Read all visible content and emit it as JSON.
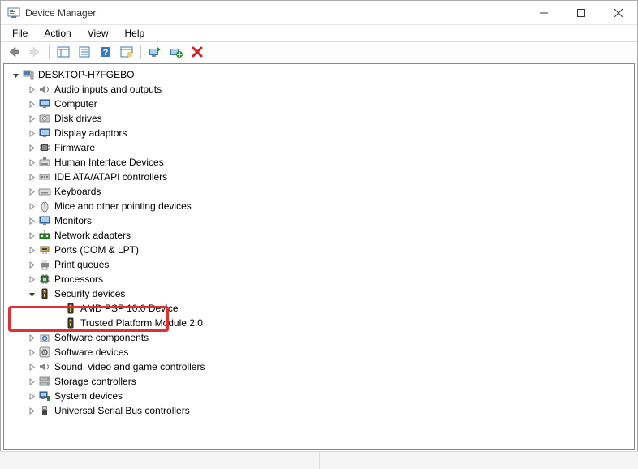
{
  "window": {
    "title": "Device Manager"
  },
  "menu": {
    "file": "File",
    "action": "Action",
    "view": "View",
    "help": "Help"
  },
  "tree": {
    "root": "DESKTOP-H7FGEBO",
    "items": [
      {
        "label": "Audio inputs and outputs",
        "icon": "speaker"
      },
      {
        "label": "Computer",
        "icon": "monitor"
      },
      {
        "label": "Disk drives",
        "icon": "disk"
      },
      {
        "label": "Display adaptors",
        "icon": "monitor"
      },
      {
        "label": "Firmware",
        "icon": "chip"
      },
      {
        "label": "Human Interface Devices",
        "icon": "hid"
      },
      {
        "label": "IDE ATA/ATAPI controllers",
        "icon": "ide"
      },
      {
        "label": "Keyboards",
        "icon": "keyboard"
      },
      {
        "label": "Mice and other pointing devices",
        "icon": "mouse"
      },
      {
        "label": "Monitors",
        "icon": "monitor"
      },
      {
        "label": "Network adapters",
        "icon": "net"
      },
      {
        "label": "Ports (COM & LPT)",
        "icon": "port"
      },
      {
        "label": "Print queues",
        "icon": "printer"
      },
      {
        "label": "Processors",
        "icon": "cpu"
      },
      {
        "label": "Security devices",
        "icon": "security",
        "expanded": true,
        "children": [
          {
            "label": "AMD PSP 10.0 Device",
            "icon": "security"
          },
          {
            "label": "Trusted Platform Module 2.0",
            "icon": "security",
            "highlighted": true
          }
        ]
      },
      {
        "label": "Software components",
        "icon": "swcomp"
      },
      {
        "label": "Software devices",
        "icon": "swdev"
      },
      {
        "label": "Sound, video and game controllers",
        "icon": "speaker"
      },
      {
        "label": "Storage controllers",
        "icon": "storage"
      },
      {
        "label": "System devices",
        "icon": "system"
      },
      {
        "label": "Universal Serial Bus controllers",
        "icon": "usb"
      }
    ]
  }
}
